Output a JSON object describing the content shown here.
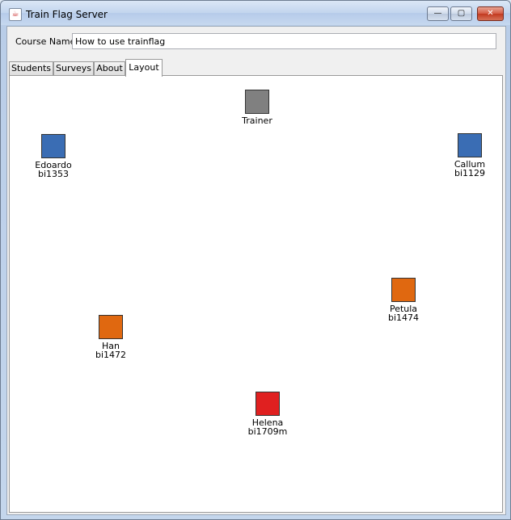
{
  "window": {
    "title": "Train Flag Server",
    "icon": "java-cup-icon"
  },
  "controls": {
    "minimize": "—",
    "maximize": "▢",
    "close": "✕"
  },
  "course": {
    "label": "Course Name",
    "value": "How to use trainflag"
  },
  "tabs": [
    {
      "label": "Students",
      "selected": false
    },
    {
      "label": "Surveys",
      "selected": false
    },
    {
      "label": "About",
      "selected": false
    },
    {
      "label": "Layout",
      "selected": true
    }
  ],
  "colors": {
    "trainer": "#808080",
    "blue": "#3a6db4",
    "orange": "#e06810",
    "red": "#e02020"
  },
  "layout": {
    "trainer": {
      "name": "Trainer"
    },
    "students": [
      {
        "name": "Edoardo",
        "id": "bi1353",
        "color": "#3a6db4"
      },
      {
        "name": "Callum",
        "id": "bi1129",
        "color": "#3a6db4"
      },
      {
        "name": "Petula",
        "id": "bi1474",
        "color": "#e06810"
      },
      {
        "name": "Han",
        "id": "bi1472",
        "color": "#e06810"
      },
      {
        "name": "Helena",
        "id": "bi1709m",
        "color": "#e02020"
      }
    ]
  }
}
